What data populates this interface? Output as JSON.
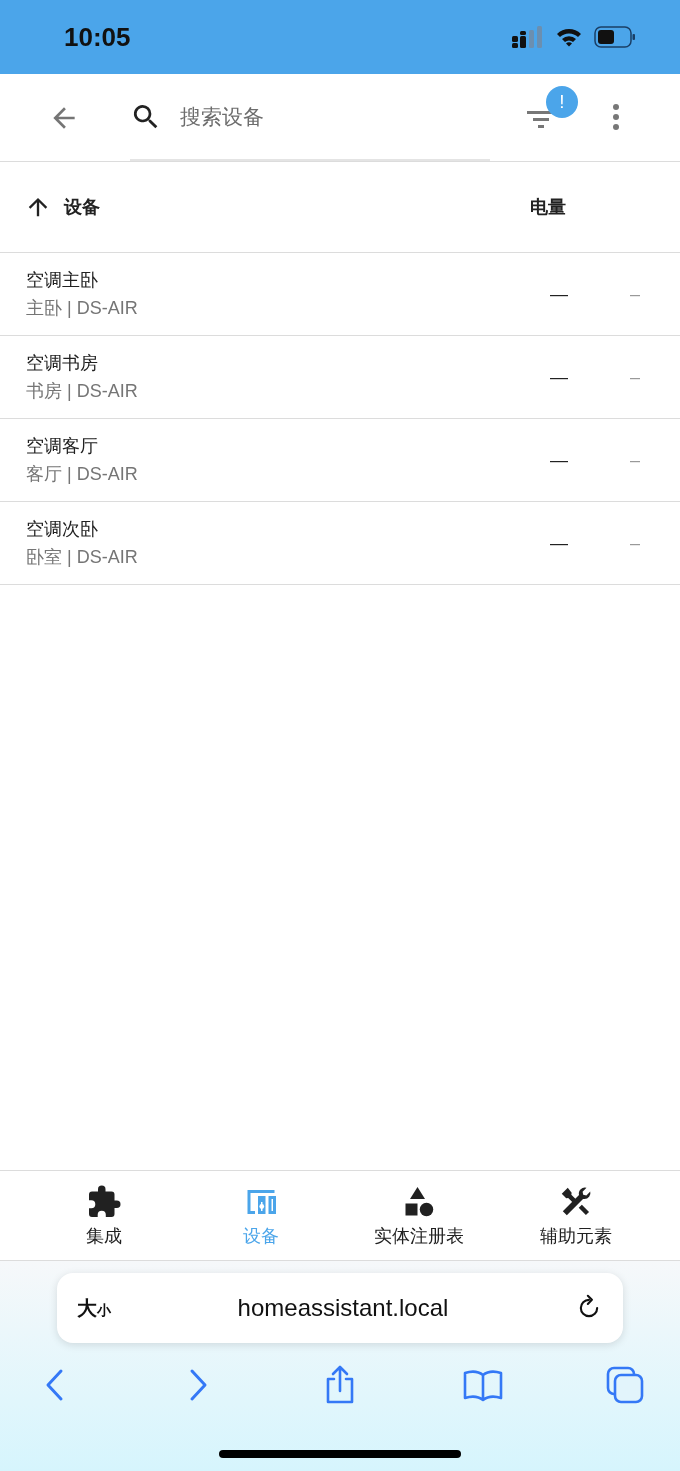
{
  "status_bar": {
    "time": "10:05"
  },
  "toolbar": {
    "search": {
      "placeholder": "搜索设备"
    },
    "filter_badge": "!"
  },
  "table": {
    "columns": [
      {
        "label": "设备",
        "sorted": true
      },
      {
        "label": "电量",
        "sorted": false
      }
    ],
    "rows": [
      {
        "name": "空调主卧",
        "subtitle": "主卧 | DS-AIR",
        "column_2": "—",
        "column_3": "–"
      },
      {
        "name": "空调书房",
        "subtitle": "书房 | DS-AIR",
        "column_2": "—",
        "column_3": "–"
      },
      {
        "name": "空调客厅",
        "subtitle": "客厅 | DS-AIR",
        "column_2": "—",
        "column_3": "–"
      },
      {
        "name": "空调次卧",
        "subtitle": "卧室 | DS-AIR",
        "column_2": "—",
        "column_3": "–"
      }
    ]
  },
  "tabs": [
    {
      "label": "集成",
      "kind": "puzzle",
      "selected": false
    },
    {
      "label": "设备",
      "kind": "devices",
      "selected": true
    },
    {
      "label": "实体注册表",
      "kind": "shapes",
      "selected": false
    },
    {
      "label": "辅助元素",
      "kind": "tools",
      "selected": false
    }
  ],
  "browser": {
    "text_size_large": "大",
    "text_size_small": "小",
    "address": "homeassistant.local"
  }
}
